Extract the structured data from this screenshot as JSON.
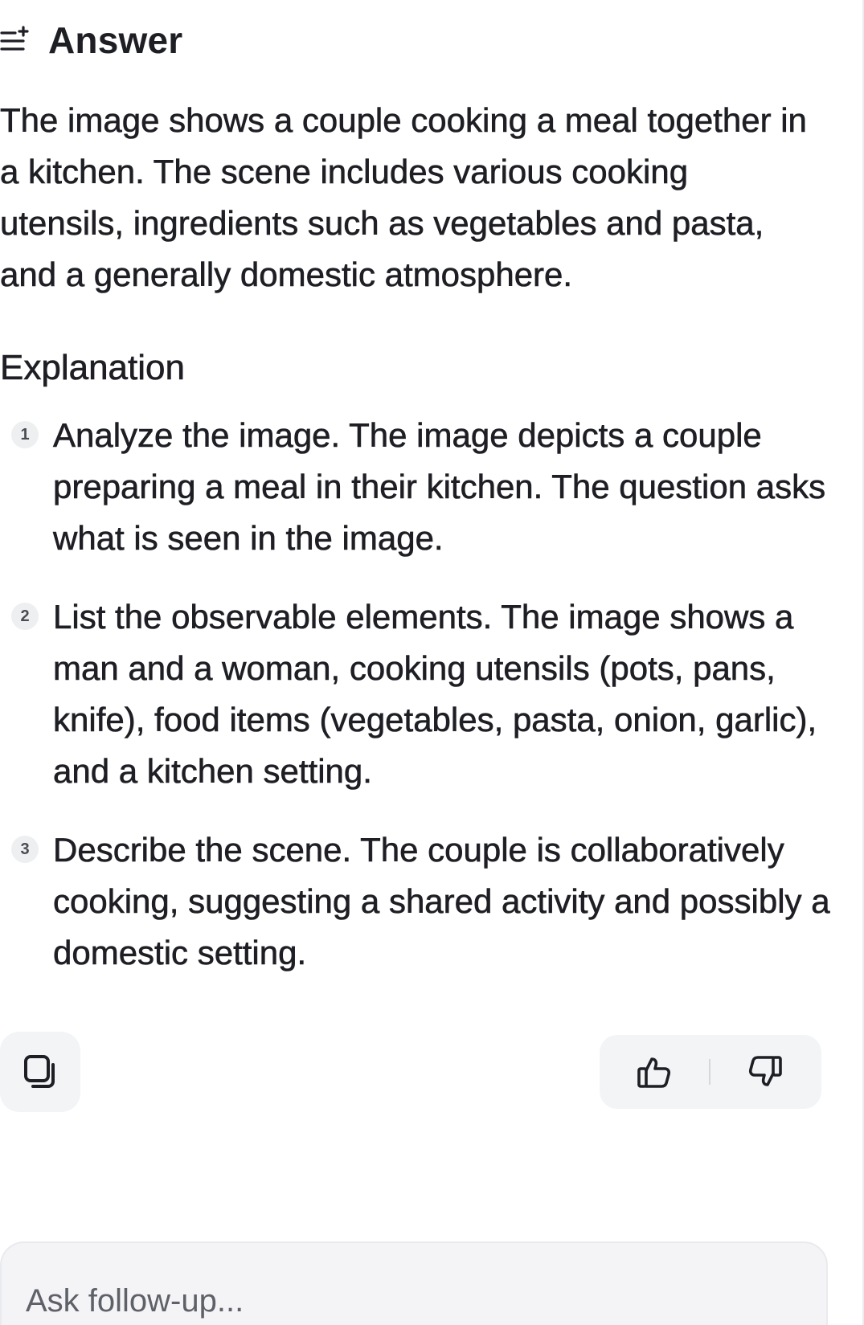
{
  "header": {
    "title": "Answer",
    "icon": "answer-sparkle-icon"
  },
  "answer": {
    "text": "The image shows a couple cooking a meal together in a kitchen. The scene includes various cooking utensils, ingredients such as vegetables and pasta, and a generally domestic atmosphere."
  },
  "explanation": {
    "heading": "Explanation",
    "steps": [
      {
        "number": "1",
        "text": "Analyze the image. The image depicts a couple preparing a meal in their kitchen. The question asks what is seen in the image."
      },
      {
        "number": "2",
        "text": "List the observable elements. The image shows a man and a woman, cooking utensils (pots, pans, knife), food items (vegetables, pasta, onion, garlic), and a kitchen setting."
      },
      {
        "number": "3",
        "text": "Describe the scene. The couple is collaboratively cooking, suggesting a shared activity and possibly a domestic setting."
      }
    ]
  },
  "actions": {
    "copy_icon": "copy-icon",
    "thumbs_up_icon": "thumbs-up-icon",
    "thumbs_down_icon": "thumbs-down-icon"
  },
  "followup": {
    "placeholder": "Ask follow-up..."
  },
  "colors": {
    "text": "#1e1f24",
    "button_background": "#f3f4f6",
    "input_background": "#f4f4f6",
    "placeholder": "#5f6169"
  }
}
